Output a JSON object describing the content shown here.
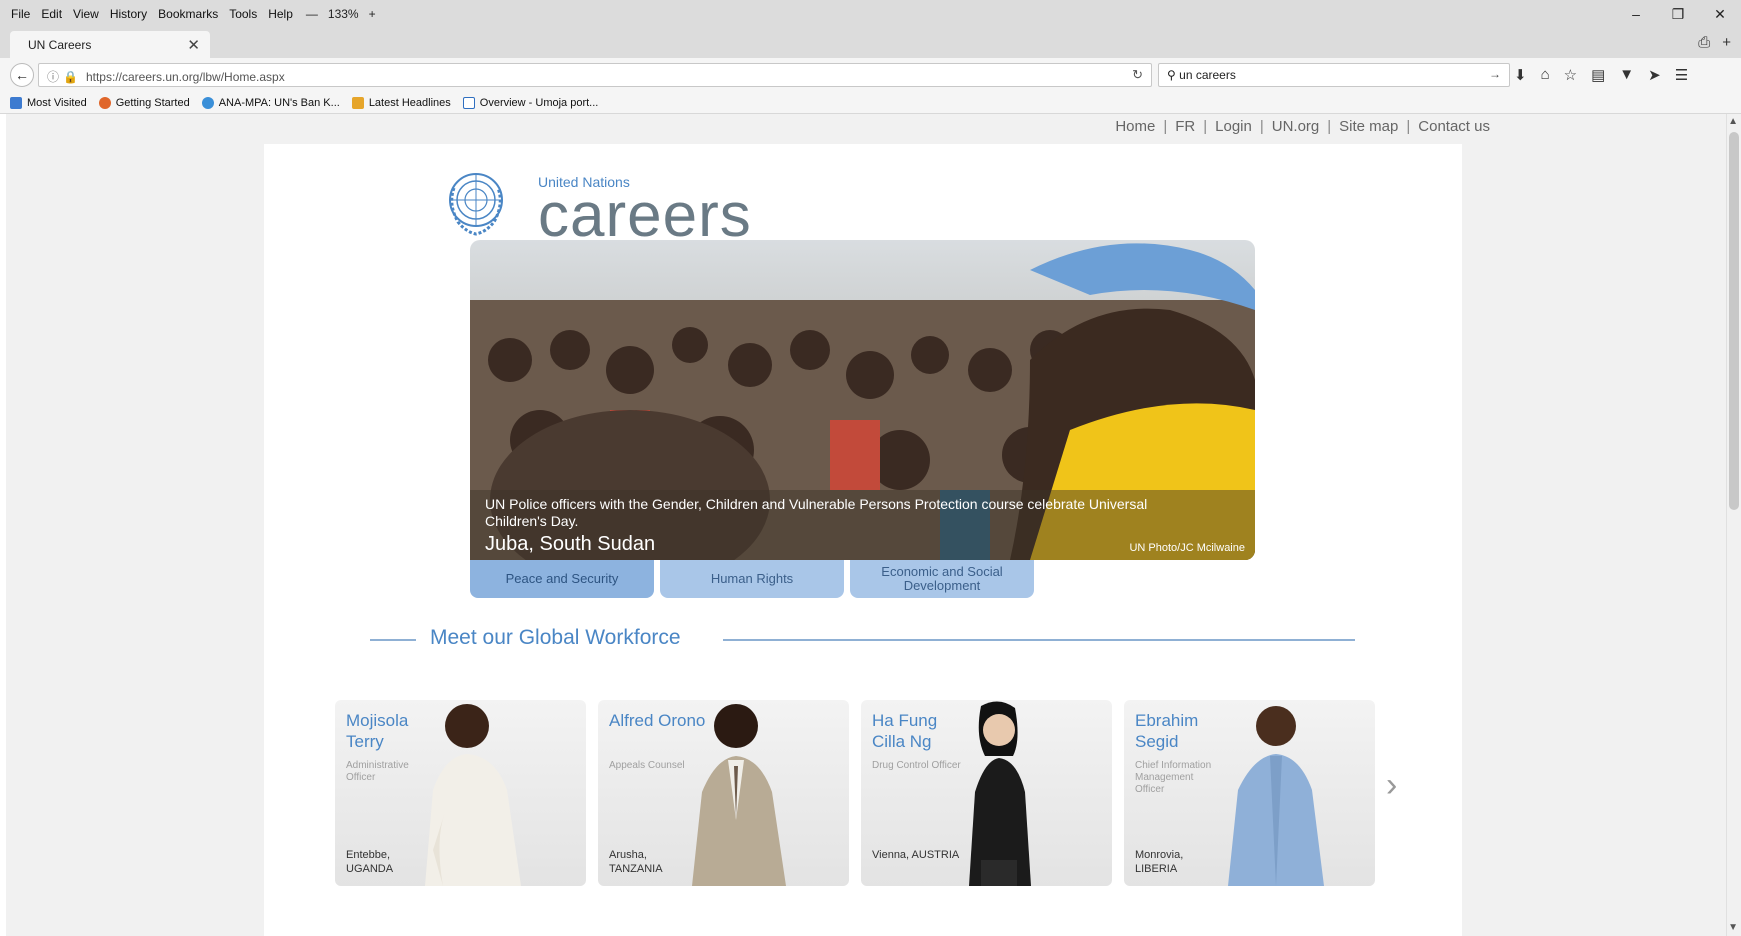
{
  "browser": {
    "menu": [
      "File",
      "Edit",
      "View",
      "History",
      "Bookmarks",
      "Tools",
      "Help"
    ],
    "zoom_minus": "—",
    "zoom": "133%",
    "zoom_plus": "+",
    "tab_title": "UN Careers",
    "url": "https://careers.un.org/lbw/Home.aspx",
    "search_value": "un careers",
    "bookmarks": [
      {
        "label": "Most Visited",
        "color": "#3d7bd0"
      },
      {
        "label": "Getting Started",
        "color": "#e0662a"
      },
      {
        "label": "ANA-MPA: UN's Ban K...",
        "color": "#3a8fd8"
      },
      {
        "label": "Latest Headlines",
        "color": "#e6a52a"
      },
      {
        "label": "Overview - Umoja port...",
        "color": "#2f6fc0"
      }
    ]
  },
  "page": {
    "topnav": [
      "Home",
      "FR",
      "Login",
      "UN.org",
      "Site map",
      "Contact us"
    ],
    "logo_small": "United Nations",
    "logo_big": "careers",
    "hero": {
      "caption": "UN Police officers with the Gender, Children and Vulnerable Persons Protection course celebrate Universal Children's Day.",
      "place": "Juba, South Sudan",
      "credit": "UN Photo/JC Mcilwaine"
    },
    "theme_tabs": [
      "Peace and Security",
      "Human Rights",
      "Economic and Social Development"
    ],
    "section_title": "Meet our Global Workforce",
    "people": [
      {
        "name": "Mojisola Terry",
        "role": "Administrative Officer",
        "location": "Entebbe, UGANDA"
      },
      {
        "name": "Alfred Orono",
        "role": "Appeals Counsel",
        "location": "Arusha, TANZANIA"
      },
      {
        "name": "Ha Fung Cilla Ng",
        "role": "Drug Control Officer",
        "location": "Vienna, AUSTRIA"
      },
      {
        "name": "Ebrahim Segid",
        "role": "Chief Information Management Officer",
        "location": "Monrovia, LIBERIA"
      }
    ],
    "accent_color": "#4a86c5"
  }
}
